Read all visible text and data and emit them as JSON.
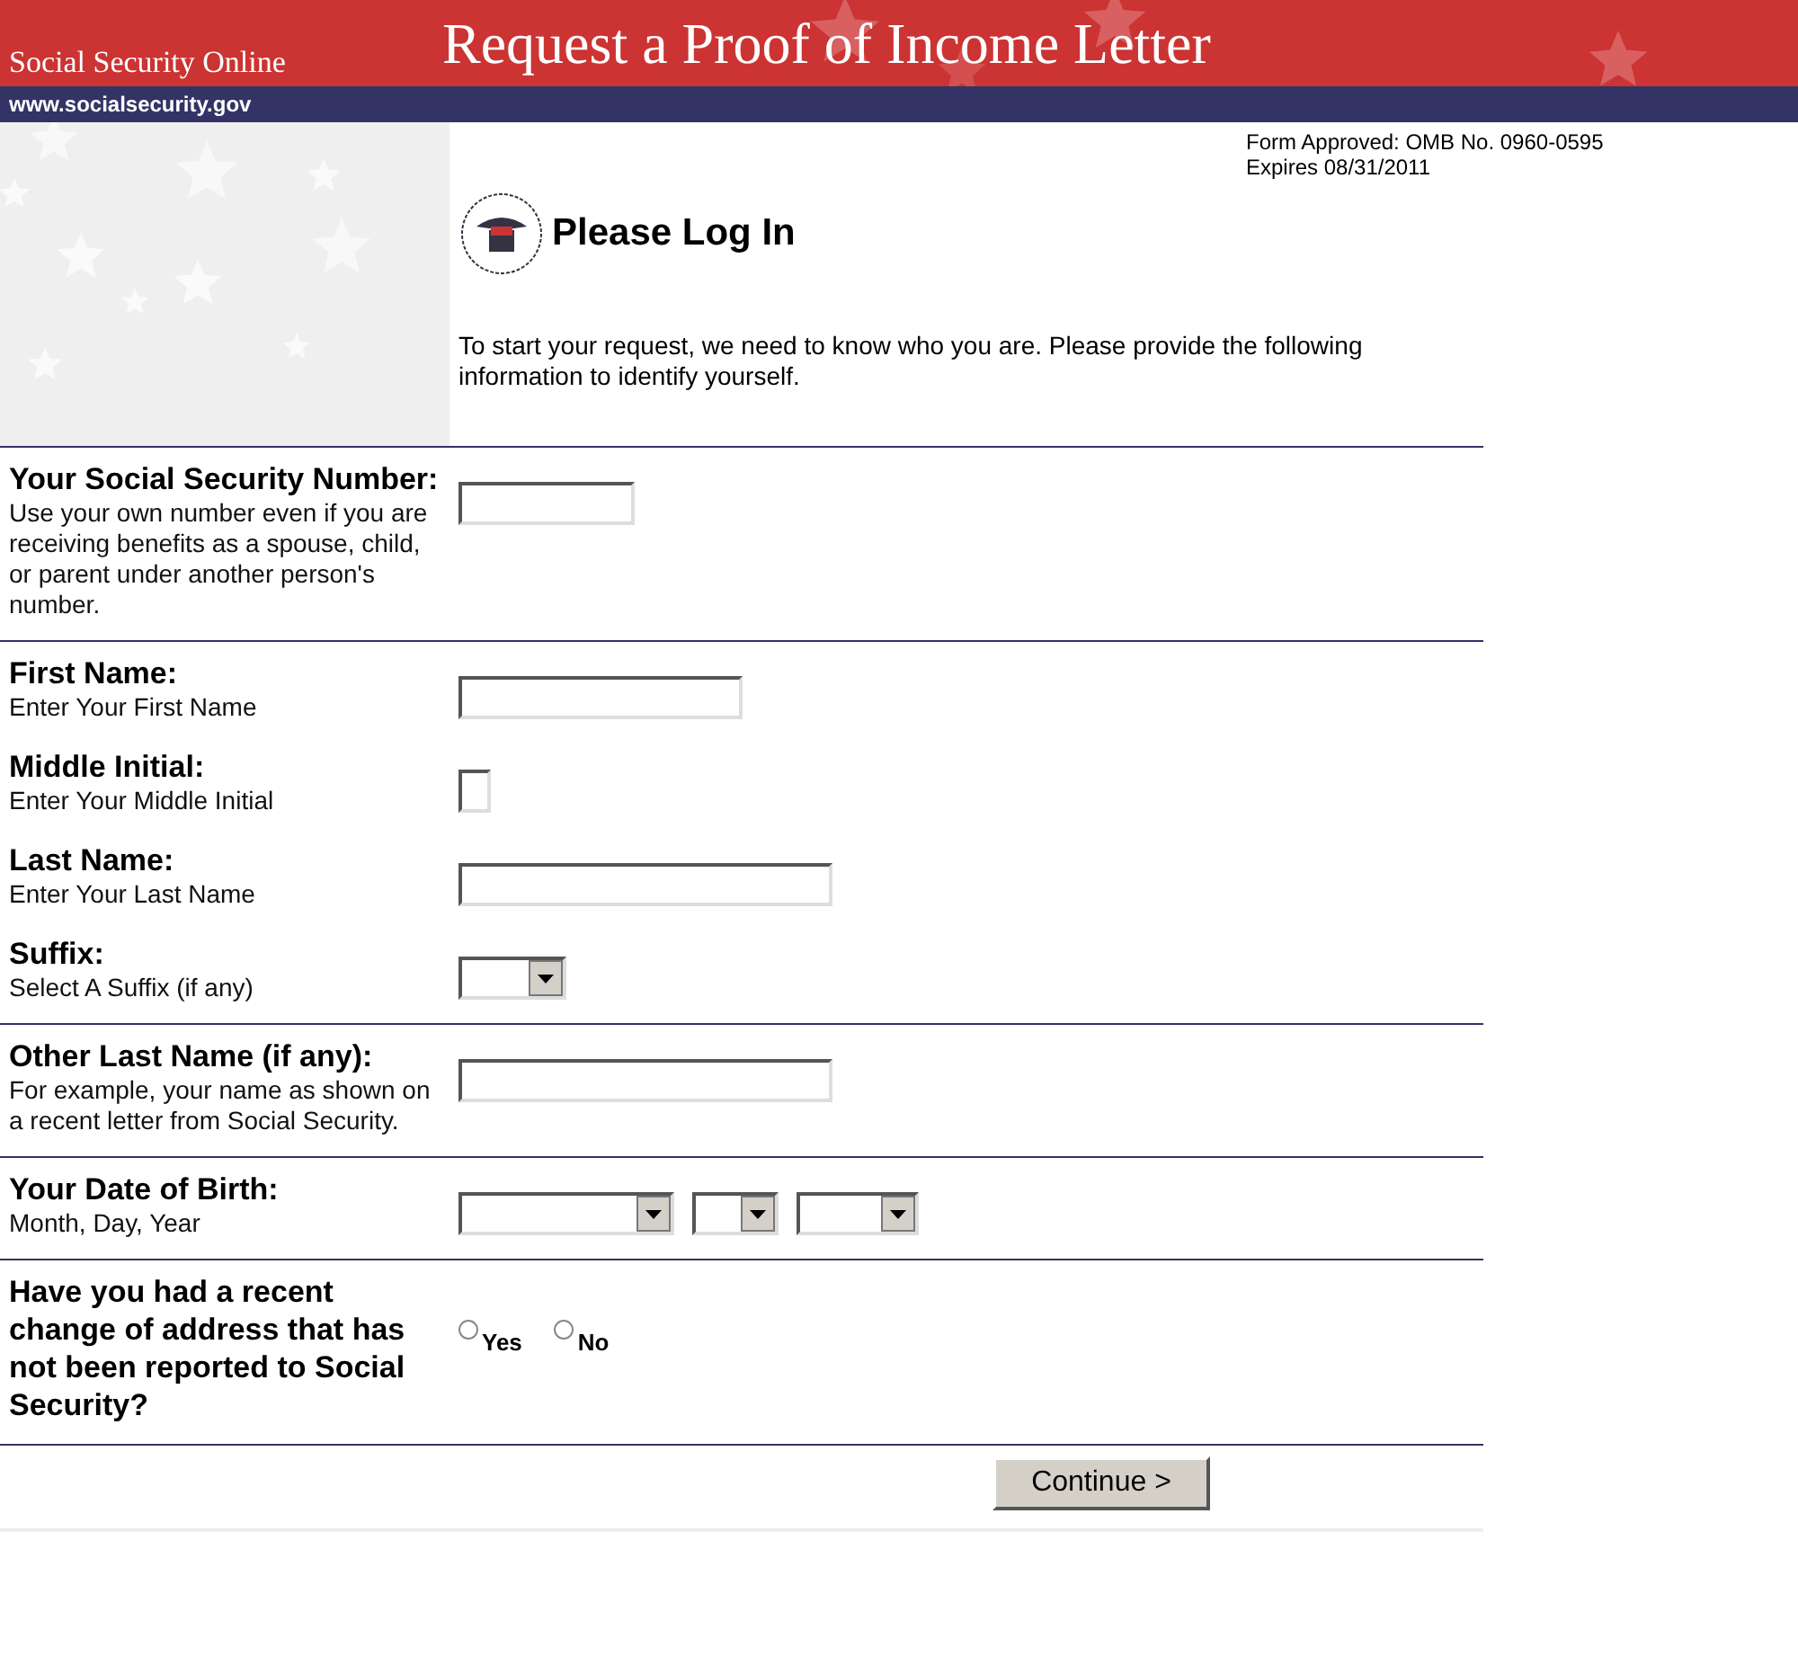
{
  "header": {
    "site": "Social Security Online",
    "title": "Request a Proof of Income Letter",
    "url": "www.socialsecurity.gov"
  },
  "form_notice": [
    "Form Approved: OMB No. 0960-0595",
    "Expires 08/31/2011"
  ],
  "heading": "Please Log In",
  "intro": "To start your request, we need to know who you are. Please provide the following information to identify yourself.",
  "sections": [
    {
      "fields": [
        {
          "label": "Your Social Security Number:",
          "hint": "Use your own number even if you are receiving benefits as a spouse, child, or parent under another person's number.",
          "kind": "text"
        }
      ]
    },
    {
      "fields": [
        {
          "label": "First Name:",
          "hint": "Enter Your First Name",
          "kind": "text"
        },
        {
          "label": "Middle Initial:",
          "hint": "Enter Your Middle Initial",
          "kind": "text"
        },
        {
          "label": "Last Name:",
          "hint": "Enter Your Last Name",
          "kind": "text"
        },
        {
          "label": "Suffix:",
          "hint": "Select A Suffix (if any)",
          "kind": "select"
        }
      ]
    },
    {
      "fields": [
        {
          "label": "Other Last Name (if any):",
          "hint": "For example, your name as shown on a recent letter from Social Security.",
          "kind": "text"
        }
      ]
    },
    {
      "fields": [
        {
          "label": "Your Date of Birth:",
          "hint": "Month, Day, Year",
          "kind": "select"
        }
      ]
    },
    {
      "fields": [
        {
          "label": "Have you had a recent change of address that has not been reported to Social Security?",
          "kind": "radio",
          "options": [
            {
              "label": "Yes",
              "selected": false
            },
            {
              "label": "No",
              "selected": false
            }
          ]
        }
      ]
    }
  ],
  "continue_button": "Continue >"
}
